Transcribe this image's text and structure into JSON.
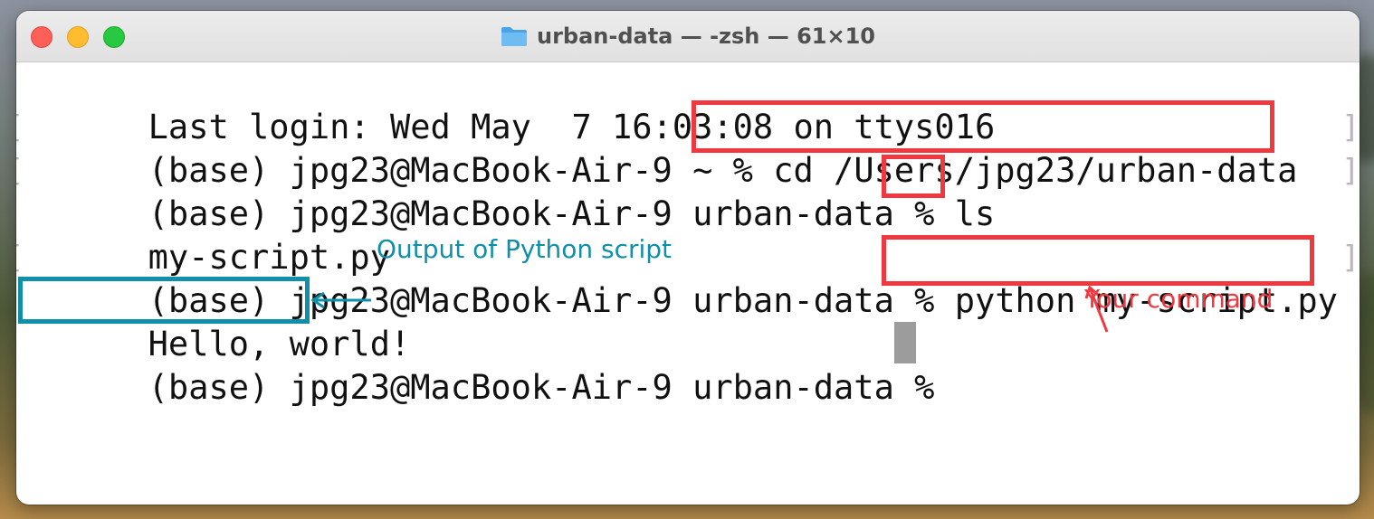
{
  "window": {
    "title": "urban-data — -zsh — 61×10"
  },
  "terminal": {
    "lines": [
      {
        "prompt": "Last login: Wed May  7 16:03:08 on ttys016",
        "command": ""
      },
      {
        "prompt": "(base) jpg23@MacBook-Air-9 ~ % ",
        "command": "cd /Users/jpg23/urban-data"
      },
      {
        "prompt": "(base) jpg23@MacBook-Air-9 urban-data % ",
        "command": "ls"
      },
      {
        "prompt": "my-script.py",
        "command": ""
      },
      {
        "prompt": "(base) jpg23@MacBook-Air-9 urban-data % ",
        "command": "python my-script.py"
      },
      {
        "prompt": "Hello, world!",
        "command": ""
      },
      {
        "prompt": "(base) jpg23@MacBook-Air-9 urban-data % ",
        "command": ""
      }
    ]
  },
  "annotations": {
    "output_label": "Output of Python script",
    "command_label": "Your command"
  },
  "colors": {
    "command_highlight": "#f0383f",
    "output_highlight": "#108fa8",
    "close": "#fe5f57",
    "minimize": "#febc2e",
    "maximize": "#28c840"
  },
  "icons": {
    "title": "folder-icon",
    "left_marks": "bracket-mark-icon"
  }
}
